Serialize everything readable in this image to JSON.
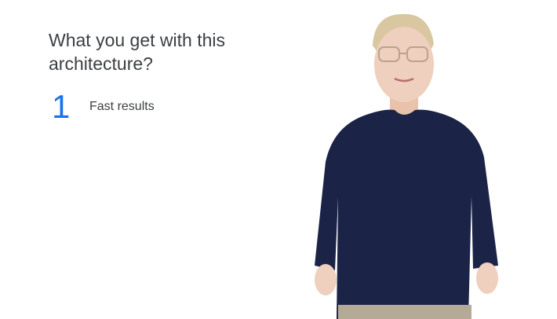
{
  "slide": {
    "title": "What you get with this\narchitecture?",
    "points": [
      {
        "number": "1",
        "text": "Fast results"
      }
    ],
    "colors": {
      "accent": "#1a73e8",
      "text": "#3c4043",
      "background": "#ffffff"
    }
  }
}
